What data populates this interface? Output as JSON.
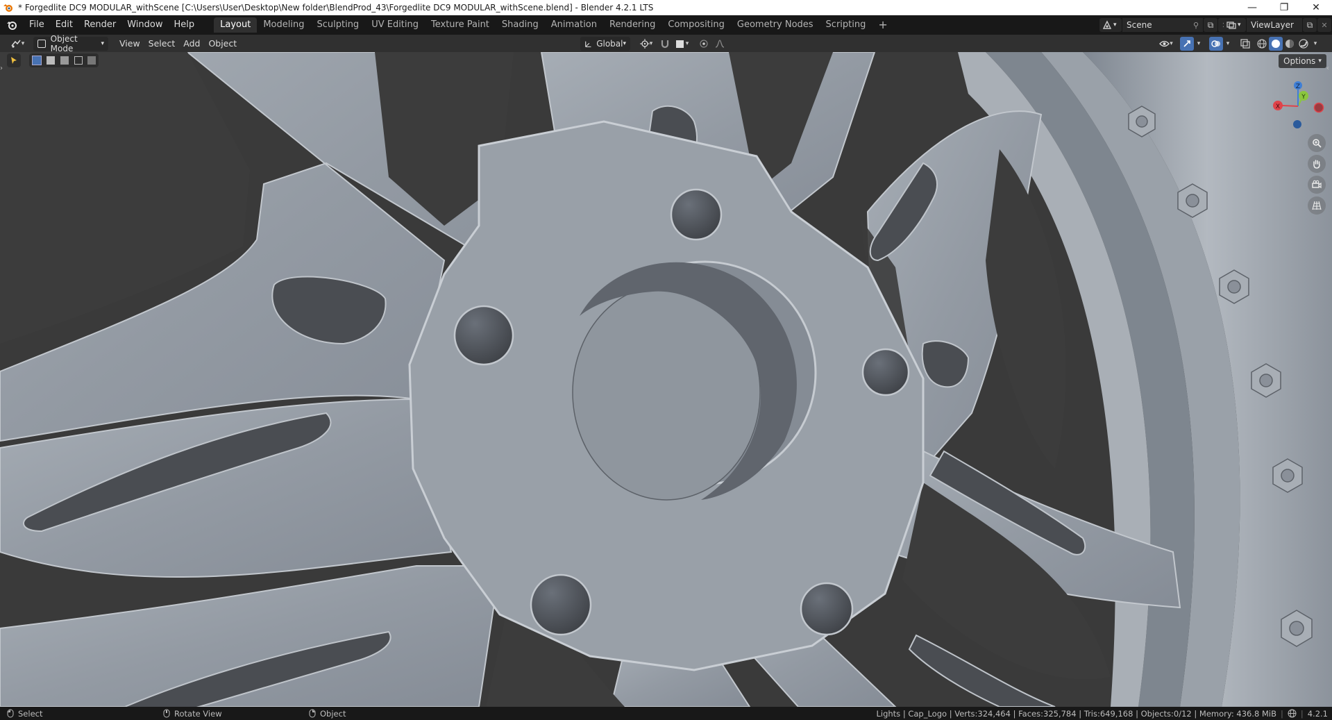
{
  "window": {
    "title": "* Forgedlite DC9 MODULAR_withScene [C:\\Users\\User\\Desktop\\New folder\\BlendProd_43\\Forgedlite DC9 MODULAR_withScene.blend] - Blender 4.2.1 LTS",
    "controls": {
      "minimize": "—",
      "maximize": "❐",
      "close": "✕"
    }
  },
  "menubar": {
    "items": [
      "File",
      "Edit",
      "Render",
      "Window",
      "Help"
    ],
    "workspaces": [
      {
        "label": "Layout",
        "active": true
      },
      {
        "label": "Modeling",
        "active": false
      },
      {
        "label": "Sculpting",
        "active": false
      },
      {
        "label": "UV Editing",
        "active": false
      },
      {
        "label": "Texture Paint",
        "active": false
      },
      {
        "label": "Shading",
        "active": false
      },
      {
        "label": "Animation",
        "active": false
      },
      {
        "label": "Rendering",
        "active": false
      },
      {
        "label": "Compositing",
        "active": false
      },
      {
        "label": "Geometry Nodes",
        "active": false
      },
      {
        "label": "Scripting",
        "active": false
      }
    ],
    "add_workspace": "+",
    "scene": "Scene",
    "view_layer": "ViewLayer"
  },
  "header": {
    "mode": "Object Mode",
    "menus": [
      "View",
      "Select",
      "Add",
      "Object"
    ],
    "transform_orientation": "Global",
    "options_label": "Options"
  },
  "gizmo": {
    "x": "X",
    "y": "Y",
    "z": "Z"
  },
  "statusbar": {
    "left": [
      {
        "icon": "mouse-left-icon",
        "label": "Select"
      },
      {
        "icon": "mouse-middle-icon",
        "label": "Rotate View"
      },
      {
        "icon": "mouse-right-icon",
        "label": "Object"
      }
    ],
    "stats": "Lights | Cap_Logo | Verts:324,464 | Faces:325,784 | Tris:649,168 | Objects:0/12 | Memory: 436.8 MiB",
    "version": "4.2.1"
  },
  "colors": {
    "accent": "#4772b3",
    "topbar": "#181818",
    "header": "#303030",
    "viewport_bg": "#3b3b3b",
    "wheel_metal": "#9aa1a9",
    "axis_x": "#e0434a",
    "axis_y": "#8bc63f",
    "axis_z": "#3f7fd6"
  }
}
